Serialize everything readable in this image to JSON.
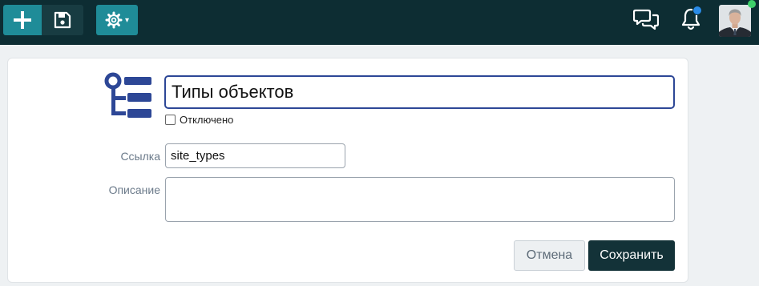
{
  "colors": {
    "topbar": "#0d2d33",
    "accent": "#1f8c98",
    "primary_button": "#133238",
    "icon_blue": "#2d4796",
    "notification_dot": "#2a8be8",
    "online_dot": "#3ed06a"
  },
  "toolbar": {
    "add_icon": "plus-icon",
    "save_icon": "floppy-disk-icon",
    "settings_icon": "gear-icon",
    "settings_caret": "▾",
    "chat_icon": "chat-bubbles-icon",
    "notifications_icon": "bell-icon",
    "avatar_icon": "user-avatar"
  },
  "form": {
    "entity_icon": "hierarchy-list-icon",
    "title_value": "Типы объектов",
    "disabled_label": "Отключено",
    "disabled_checked": false,
    "link_label": "Ссылка",
    "link_value": "site_types",
    "description_label": "Описание",
    "description_value": "",
    "cancel_label": "Отмена",
    "save_label": "Сохранить"
  }
}
